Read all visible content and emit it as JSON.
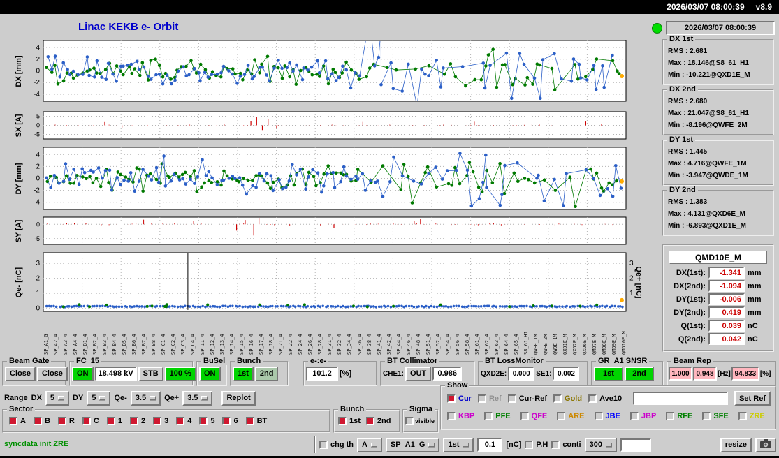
{
  "colors": {
    "title_blue": "#0000cc",
    "on_green": "#00d400",
    "dull_green": "#aac8aa",
    "pink": "#ffb6be",
    "value_red": "#cc0000",
    "checkbox_red": "#d01830",
    "led_green": "#00dd00",
    "series_green": "#007a00",
    "series_blue": "#2b5fc7",
    "bars_red": "#cc0000",
    "marker_orange": "#ffaa00",
    "status_green": "#009000"
  },
  "titlebar": {
    "datetime": "2026/03/07 08:00:39",
    "version": "v8.9"
  },
  "header": {
    "title": "Linac KEKB e- Orbit"
  },
  "status_panel": {
    "timestamp": "2026/03/07 08:00:39",
    "groups": [
      {
        "label": "DX 1st",
        "rms": "RMS : 2.681",
        "max": "Max : 18.146@S8_61_H1",
        "min": "Min : -10.221@QXD1E_M"
      },
      {
        "label": "DX 2nd",
        "rms": "RMS : 2.680",
        "max": "Max : 21.047@S8_61_H1",
        "min": "Min : -8.196@QWFE_2M"
      },
      {
        "label": "DY 1st",
        "rms": "RMS : 1.445",
        "max": "Max : 4.716@QWFE_1M",
        "min": "Min : -3.947@QWDE_1M"
      },
      {
        "label": "DY 2nd",
        "rms": "RMS : 1.383",
        "max": "Max : 4.131@QXD6E_M",
        "min": "Min : -6.893@QXD1E_M"
      }
    ],
    "monitor": {
      "name": "QMD10E_M",
      "rows": [
        {
          "label": "DX(1st):",
          "value": "-1.341",
          "unit": "mm"
        },
        {
          "label": "DX(2nd):",
          "value": "-1.094",
          "unit": "mm"
        },
        {
          "label": "DY(1st):",
          "value": "-0.006",
          "unit": "mm"
        },
        {
          "label": "DY(2nd):",
          "value": "0.419",
          "unit": "mm"
        },
        {
          "label": "Q(1st):",
          "value": "0.039",
          "unit": "nC"
        },
        {
          "label": "Q(2nd):",
          "value": "0.042",
          "unit": "nC"
        }
      ]
    }
  },
  "plots": {
    "dx": {
      "ylabel": "DX [mm]",
      "yticks": [
        4,
        2,
        0,
        -2,
        -4
      ],
      "ylim": [
        -5.2,
        5.2
      ]
    },
    "sx": {
      "ylabel": "SX [A]",
      "yticks": [
        5,
        0,
        -5
      ],
      "ylim": [
        -7.5,
        7.5
      ]
    },
    "dy": {
      "ylabel": "DY [mm]",
      "yticks": [
        4,
        2,
        0,
        -2,
        -4
      ],
      "ylim": [
        -5.2,
        5.2
      ]
    },
    "sy": {
      "ylabel": "SY [A]",
      "yticks": [
        0,
        -5
      ],
      "ylim": [
        -7,
        2.5
      ]
    },
    "q": {
      "ylabel": "Qe- [nC]",
      "ylabel_right": "Qe+ [nC]",
      "yticks": [
        3,
        2,
        1,
        0
      ],
      "yticks_right": [
        3,
        2,
        1
      ],
      "ylim": [
        -0.2,
        3.7
      ]
    },
    "xticklabels": [
      "SP_A1_G",
      "SP_A2_4",
      "SP_A3_4",
      "SP_A4_4",
      "SP_B1_4",
      "SP_B2_4",
      "SP_B3_4",
      "SP_B4_4",
      "SP_B5_4",
      "SP_B6_4",
      "SP_B7_4",
      "SP_B8_4",
      "SP_C1_4",
      "SP_C2_4",
      "SP_C3_4",
      "SP_C4_4",
      "SP_11_4",
      "SP_12_4",
      "SP_13_4",
      "SP_14_4",
      "SP_15_4",
      "SP_16_4",
      "SP_17_4",
      "SP_18_4",
      "SP_21_4",
      "SP_22_4",
      "SP_24_4",
      "SP_26_4",
      "SP_28_4",
      "SP_31_4",
      "SP_32_4",
      "SP_34_4",
      "SP_36_4",
      "SP_38_4",
      "SP_41_4",
      "SP_42_4",
      "SP_44_4",
      "SP_46_4",
      "SP_48_4",
      "SP_51_4",
      "SP_52_4",
      "SP_54_4",
      "SP_56_4",
      "SP_58_4",
      "SP_61_4",
      "SP_62_4",
      "SP_63_4",
      "SP_64_4",
      "SP_65_4",
      "S8_61_H1",
      "QWFE_1M",
      "QWFE_2M",
      "QWDE_1M",
      "QXD1E_M",
      "QXD2E_M",
      "QXD6E_M",
      "QMD7E_M",
      "QMD8E_M",
      "QMD9E_M",
      "QMD10E_M"
    ]
  },
  "controls": {
    "beam_gate": {
      "label": "Beam Gate",
      "close1": "Close",
      "close2": "Close"
    },
    "fc15": {
      "label": "FC_15",
      "on": "ON",
      "kv": "18.498 kV",
      "stb": "STB",
      "pct": "100 %"
    },
    "busel": {
      "label": "BuSel",
      "on": "ON"
    },
    "bunch": {
      "label": "Bunch",
      "first": "1st",
      "second": "2nd"
    },
    "ee": {
      "label": "e-:e-",
      "value": "101.2",
      "unit": "[%]"
    },
    "bt_collimator": {
      "label": "BT Collimator",
      "che1": "CHE1:",
      "state": "OUT",
      "value": "0.986"
    },
    "bt_lossmonitor": {
      "label": "BT LossMonitor",
      "qxd2e_label": "QXD2E:",
      "qxd2e_value": "0.000",
      "se1_label": "SE1:",
      "se1_value": "0.002"
    },
    "gr_a1": {
      "label": "GR_A1 SNSR",
      "first": "1st",
      "second": "2nd"
    },
    "beam_rep": {
      "label": "Beam Rep",
      "v1": "1.000",
      "v2": "0.948",
      "hz": "[Hz]",
      "v3": "94.833",
      "pct": "[%]"
    },
    "range": {
      "label": "Range",
      "dx_label": "DX",
      "dx": "5",
      "dy_label": "DY",
      "dy": "5",
      "qem_label": "Qe-",
      "qem": "3.5",
      "qep_label": "Qe+",
      "qep": "3.5",
      "replot": "Replot"
    },
    "show": {
      "label": "Show",
      "row1": [
        {
          "label": "Cur",
          "color": "#0000cd",
          "checked": true
        },
        {
          "label": "Ref",
          "color": "#909090",
          "checked": false
        },
        {
          "label": "Cur-Ref",
          "color": "#000000",
          "checked": false
        },
        {
          "label": "Gold",
          "color": "#8a7500",
          "checked": false
        },
        {
          "label": "Ave10",
          "color": "#000000",
          "checked": false
        }
      ],
      "entry": "",
      "set_ref": "Set Ref",
      "row2": [
        {
          "label": "KBP",
          "color": "#cc00cc",
          "checked": false
        },
        {
          "label": "PFE",
          "color": "#008000",
          "checked": false
        },
        {
          "label": "QFE",
          "color": "#cc00cc",
          "checked": false
        },
        {
          "label": "ARE",
          "color": "#cc8800",
          "checked": false
        },
        {
          "label": "JBE",
          "color": "#0000ff",
          "checked": false
        },
        {
          "label": "JBP",
          "color": "#cc00cc",
          "checked": false
        },
        {
          "label": "RFE",
          "color": "#008000",
          "checked": false
        },
        {
          "label": "SFE",
          "color": "#008000",
          "checked": false
        },
        {
          "label": "ZRE",
          "color": "#cccc00",
          "checked": false
        }
      ]
    },
    "sector": {
      "label": "Sector",
      "items": [
        {
          "label": "A",
          "checked": true
        },
        {
          "label": "B",
          "checked": true
        },
        {
          "label": "R",
          "checked": true
        },
        {
          "label": "C",
          "checked": true
        },
        {
          "label": "1",
          "checked": true
        },
        {
          "label": "2",
          "checked": true
        },
        {
          "label": "3",
          "checked": true
        },
        {
          "label": "4",
          "checked": true
        },
        {
          "label": "5",
          "checked": true
        },
        {
          "label": "6",
          "checked": true
        },
        {
          "label": "BT",
          "checked": true
        }
      ]
    },
    "bunch2": {
      "label": "Bunch",
      "items": [
        {
          "label": "1st",
          "checked": true
        },
        {
          "label": "2nd",
          "checked": true
        }
      ]
    },
    "sigma": {
      "label": "Sigma",
      "item": {
        "label": "visible",
        "checked": false
      }
    }
  },
  "statusbar": {
    "message": "syncdata init ZRE",
    "chg_th": {
      "label": "chg th",
      "checked": false
    },
    "mode": "A",
    "device": "SP_A1_G",
    "bunch": "1st",
    "threshold": "0.1",
    "unit": "[nC]",
    "ph": {
      "label": "P.H",
      "checked": false
    },
    "conti": {
      "label": "conti",
      "checked": false
    },
    "count": "300",
    "entry": "",
    "resize": "resize"
  }
}
